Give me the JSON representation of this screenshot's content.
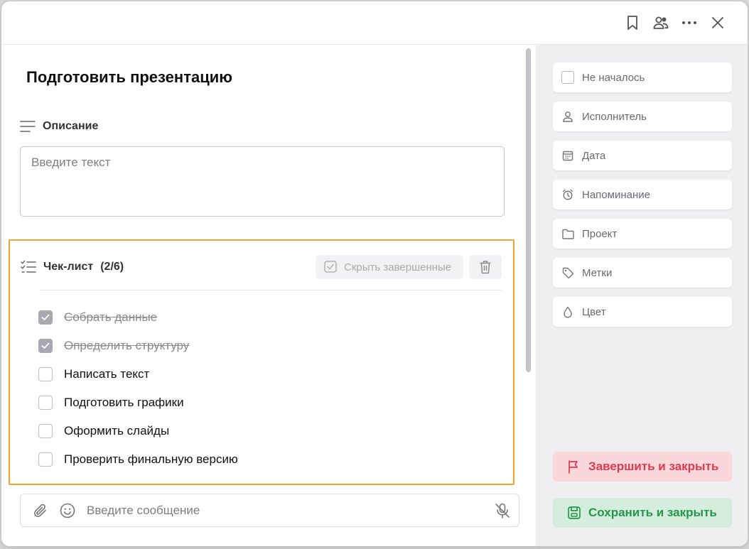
{
  "title": "Подготовить презентацию",
  "description": {
    "label": "Описание",
    "placeholder": "Введите текст"
  },
  "checklist": {
    "label": "Чек-лист",
    "count": "(2/6)",
    "hide_completed_label": "Скрыть завершенные",
    "items": [
      {
        "text": "Собрать данные",
        "done": true
      },
      {
        "text": "Определить структуру",
        "done": true
      },
      {
        "text": "Написать текст",
        "done": false
      },
      {
        "text": "Подготовить графики",
        "done": false
      },
      {
        "text": "Оформить слайды",
        "done": false
      },
      {
        "text": "Проверить финальную версию",
        "done": false
      }
    ]
  },
  "composer": {
    "placeholder": "Введите сообщение"
  },
  "properties": [
    {
      "label": "Не началось",
      "icon": "status-checkbox-icon"
    },
    {
      "label": "Исполнитель",
      "icon": "user-icon"
    },
    {
      "label": "Дата",
      "icon": "calendar-icon"
    },
    {
      "label": "Напоминание",
      "icon": "alarm-clock-icon"
    },
    {
      "label": "Проект",
      "icon": "folder-icon"
    },
    {
      "label": "Метки",
      "icon": "tag-icon"
    },
    {
      "label": "Цвет",
      "icon": "droplet-icon"
    }
  ],
  "actions": {
    "finish_label": "Завершить и закрыть",
    "save_label": "Сохранить и закрыть"
  },
  "colors": {
    "highlight_border": "#f5a02e",
    "finish_text": "#e03a4f",
    "finish_bg": "#f9d7db",
    "save_text": "#25964a",
    "save_bg": "#d4eddc"
  }
}
